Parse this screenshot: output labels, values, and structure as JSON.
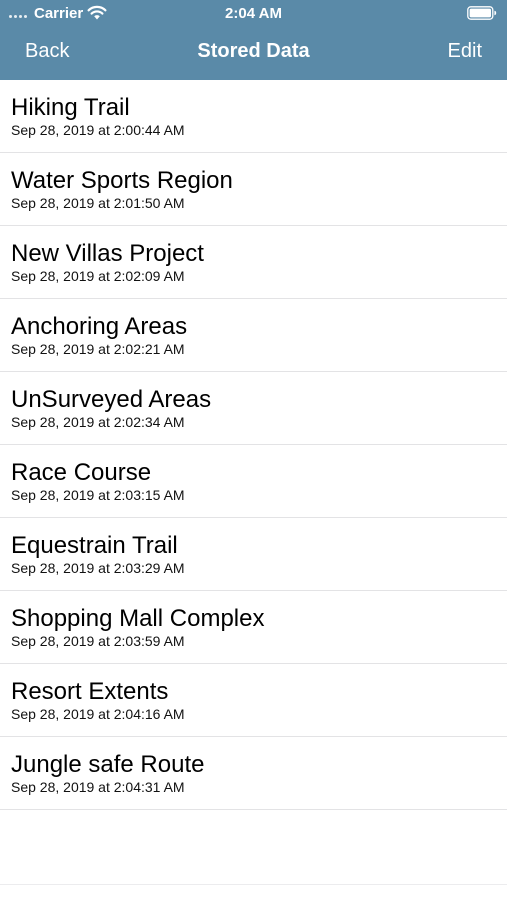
{
  "status_bar": {
    "carrier": "Carrier",
    "time": "2:04 AM",
    "signal_icon": "signal-dots-icon",
    "wifi_icon": "wifi-icon",
    "battery_icon": "battery-icon"
  },
  "nav": {
    "back_label": "Back",
    "title": "Stored Data",
    "edit_label": "Edit"
  },
  "colors": {
    "nav_background": "#5a8aa8",
    "nav_text": "#ffffff",
    "separator": "#e3e3e5"
  },
  "items": [
    {
      "title": "Hiking Trail",
      "date": "Sep 28, 2019 at 2:00:44 AM"
    },
    {
      "title": "Water Sports Region",
      "date": "Sep 28, 2019 at 2:01:50 AM"
    },
    {
      "title": "New Villas Project",
      "date": "Sep 28, 2019 at 2:02:09 AM"
    },
    {
      "title": "Anchoring Areas",
      "date": "Sep 28, 2019 at 2:02:21 AM"
    },
    {
      "title": "UnSurveyed Areas",
      "date": "Sep 28, 2019 at 2:02:34 AM"
    },
    {
      "title": "Race Course",
      "date": "Sep 28, 2019 at 2:03:15 AM"
    },
    {
      "title": "Equestrain Trail",
      "date": "Sep 28, 2019 at 2:03:29 AM"
    },
    {
      "title": "Shopping Mall Complex",
      "date": "Sep 28, 2019 at 2:03:59 AM"
    },
    {
      "title": "Resort Extents",
      "date": "Sep 28, 2019 at 2:04:16 AM"
    },
    {
      "title": "Jungle safe Route",
      "date": "Sep 28, 2019 at 2:04:31 AM"
    }
  ]
}
